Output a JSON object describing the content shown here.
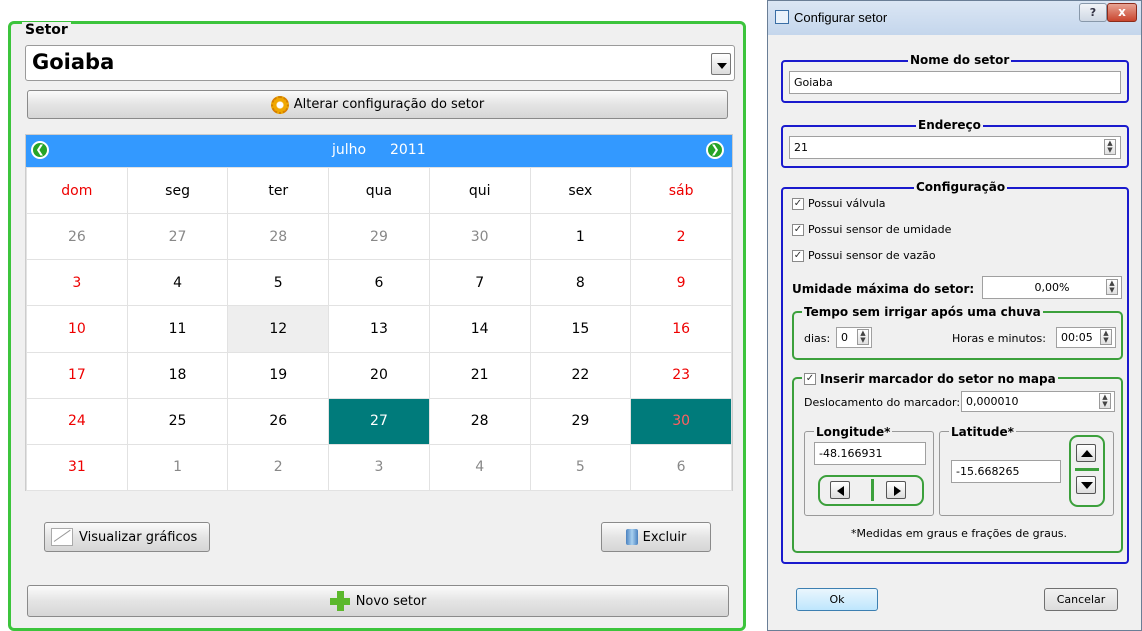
{
  "left": {
    "group_title": "Setor",
    "setor_selected": "Goiaba",
    "alterar_label": "Alterar configuração do setor",
    "calendar": {
      "month": "julho",
      "year": "2011",
      "weekdays": [
        "dom",
        "seg",
        "ter",
        "qua",
        "qui",
        "sex",
        "sáb"
      ],
      "weeks": [
        [
          "26",
          "27",
          "28",
          "29",
          "30",
          "1",
          "2"
        ],
        [
          "3",
          "4",
          "5",
          "6",
          "7",
          "8",
          "9"
        ],
        [
          "10",
          "11",
          "12",
          "13",
          "14",
          "15",
          "16"
        ],
        [
          "17",
          "18",
          "19",
          "20",
          "21",
          "22",
          "23"
        ],
        [
          "24",
          "25",
          "26",
          "27",
          "28",
          "29",
          "30"
        ],
        [
          "31",
          "1",
          "2",
          "3",
          "4",
          "5",
          "6"
        ]
      ]
    },
    "visualizar_label": "Visualizar gráficos",
    "excluir_label": "Excluir",
    "novo_label": "Novo setor"
  },
  "dialog": {
    "title": "Configurar setor",
    "help": "?",
    "close": "x",
    "nome_title": "Nome do setor",
    "nome_value": "Goiaba",
    "endereco_title": "Endereço",
    "endereco_value": "21",
    "config_title": "Configuração",
    "chk_valvula": "Possui válvula",
    "chk_umidade": "Possui sensor de umidade",
    "chk_vazao": "Possui sensor de vazão",
    "umidade_label": "Umidade máxima do setor:",
    "umidade_value": "0,00%",
    "tempo_title": "Tempo sem irrigar após uma chuva",
    "dias_label": "dias:",
    "dias_value": "0",
    "horas_label": "Horas e minutos:",
    "horas_value": "00:05",
    "marcador_label": "Inserir marcador do setor no mapa",
    "desloc_label": "Deslocamento do marcador:",
    "desloc_value": "0,000010",
    "longitude_title": "Longitude*",
    "longitude_value": "-48.166931",
    "latitude_title": "Latitude*",
    "latitude_value": "-15.668265",
    "note": "*Medidas em graus e frações de graus.",
    "ok_label": "Ok",
    "cancel_label": "Cancelar"
  }
}
